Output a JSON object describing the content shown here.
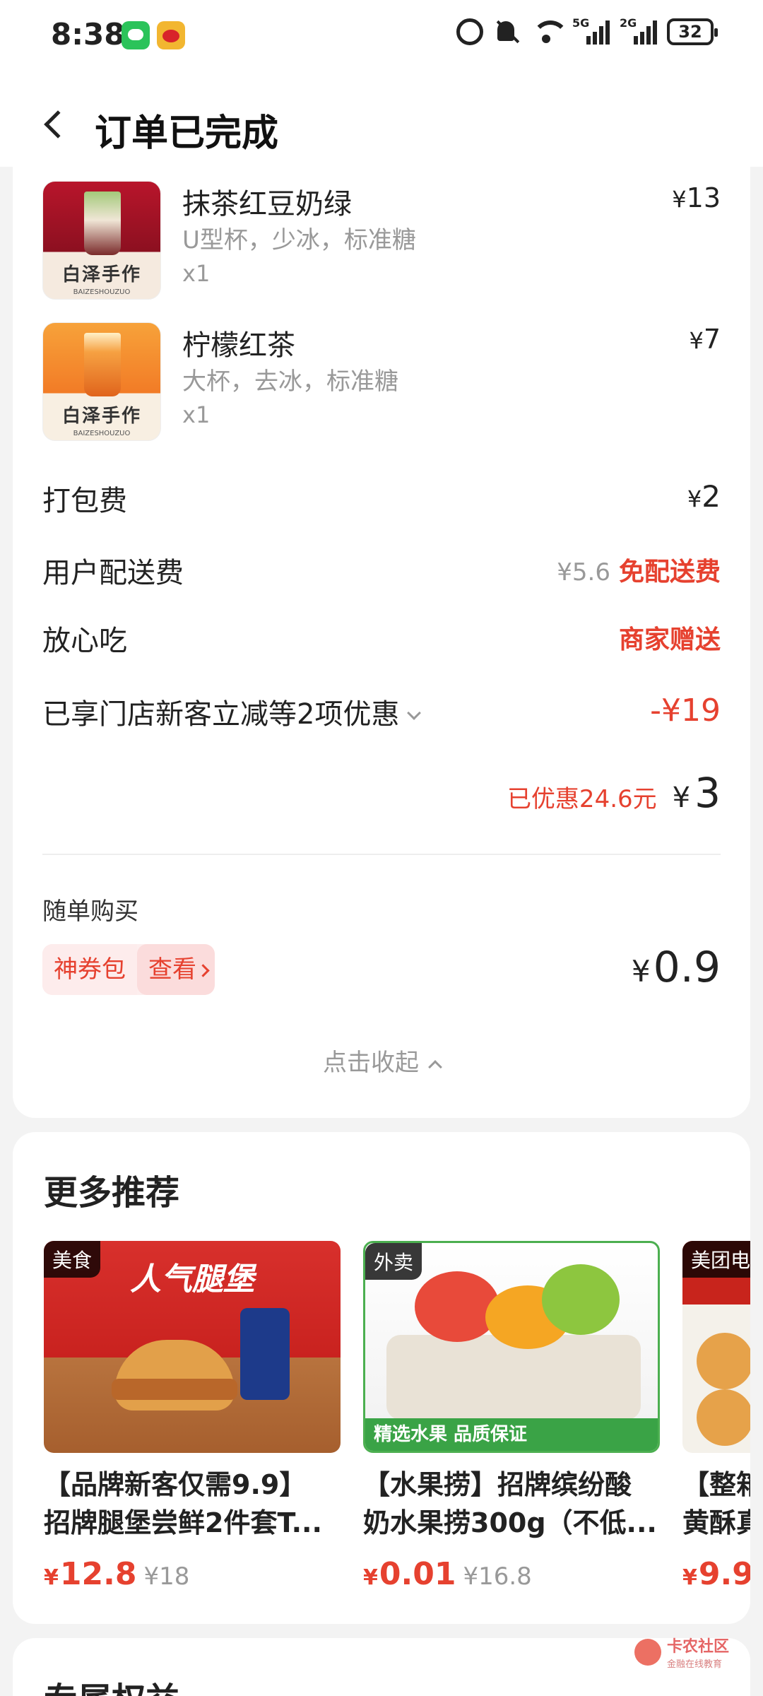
{
  "status_bar": {
    "time": "8:38",
    "battery": "32",
    "net1": "5G",
    "net2": "2G",
    "icons": [
      "wechat-icon",
      "weibo-icon",
      "alarm-icon",
      "mute-icon",
      "wifi-icon",
      "signal-icon",
      "battery-icon"
    ]
  },
  "header": {
    "title": "订单已完成"
  },
  "order": {
    "items": [
      {
        "name": "抹茶红豆奶绿",
        "spec": "U型杯，少冰，标准糖",
        "qty": "x1",
        "price": "13",
        "brand": "白泽手作",
        "brand_en": "BAIZESHOUZUO"
      },
      {
        "name": "柠檬红茶",
        "spec": "大杯，去冰，标准糖",
        "qty": "x1",
        "price": "7",
        "brand": "白泽手作",
        "brand_en": "BAIZESHOUZUO"
      }
    ],
    "currency": "¥",
    "packing": {
      "label": "打包费",
      "value": "2"
    },
    "delivery": {
      "label": "用户配送费",
      "original": "¥5.6",
      "status": "免配送费"
    },
    "assurance": {
      "label": "放心吃",
      "status": "商家赠送"
    },
    "discount": {
      "label": "已享门店新客立减等2项优惠",
      "value": "-¥19"
    },
    "total": {
      "saved": "已优惠24.6元",
      "amount": "3"
    },
    "addon": {
      "title": "随单购买",
      "coupon_name": "神券包",
      "coupon_action": "查看",
      "price": "0.9"
    },
    "collapse_label": "点击收起"
  },
  "recommendations": {
    "title": "更多推荐",
    "items": [
      {
        "badge": "美食",
        "image_text": "人气腿堡",
        "line1": "【品牌新客仅需9.9】",
        "line2": "招牌腿堡尝鲜2件套T...",
        "price": "12.8",
        "orig": "¥18"
      },
      {
        "badge": "外卖",
        "image_text": "精选水果 品质保证",
        "line1": "【水果捞】招牌缤纷酸",
        "line2": "奶水果捞300g（不低...",
        "price": "0.01",
        "orig": "¥16.8"
      },
      {
        "badge": "美团电",
        "image_text": "",
        "line1": "【整箱",
        "line2": "黄酥真",
        "price": "9.9",
        "orig": ""
      }
    ]
  },
  "exclusive": {
    "title": "专属权益"
  },
  "watermark": {
    "main": "卡农社区",
    "sub": "金融在线教育"
  }
}
